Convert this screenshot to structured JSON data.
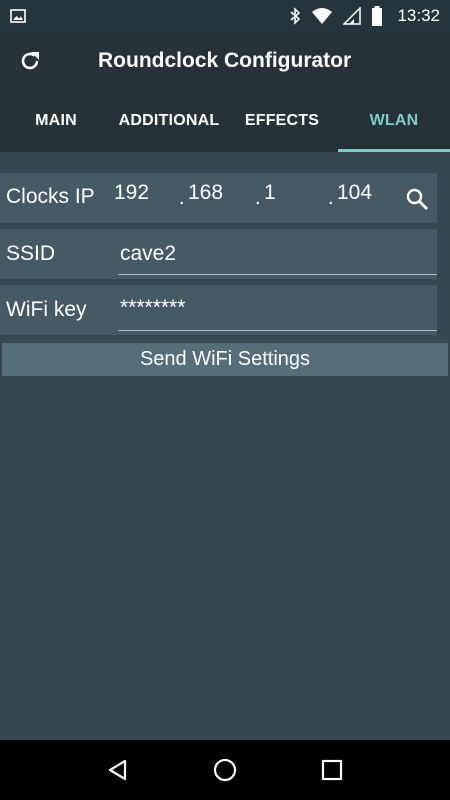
{
  "status_bar": {
    "time": "13:32",
    "icons": [
      "image-icon",
      "bluetooth-icon",
      "wifi-icon",
      "signal-icon",
      "battery-icon"
    ]
  },
  "app_bar": {
    "title": "Roundclock Configurator",
    "refresh_icon": "refresh-icon"
  },
  "tabs": [
    {
      "label": "MAIN",
      "active": false
    },
    {
      "label": "ADDITIONAL",
      "active": false
    },
    {
      "label": "EFFECTS",
      "active": false
    },
    {
      "label": "WLAN",
      "active": true
    }
  ],
  "wlan": {
    "clocks_ip": {
      "label": "Clocks IP",
      "octets": [
        "192",
        "168",
        "1",
        "104"
      ],
      "search_icon": "search-icon"
    },
    "ssid": {
      "label": "SSID",
      "value": "cave2"
    },
    "wifi_key": {
      "label": "WiFi key",
      "value": "********"
    },
    "send_button": "Send WiFi Settings"
  },
  "nav_bar": {
    "icons": [
      "back-icon",
      "home-icon",
      "recents-icon"
    ]
  },
  "colors": {
    "background": "#37474f",
    "app_bar": "#263238",
    "accent": "#80cbc4",
    "row_background": "#455a64",
    "button_background": "#546e7a"
  }
}
